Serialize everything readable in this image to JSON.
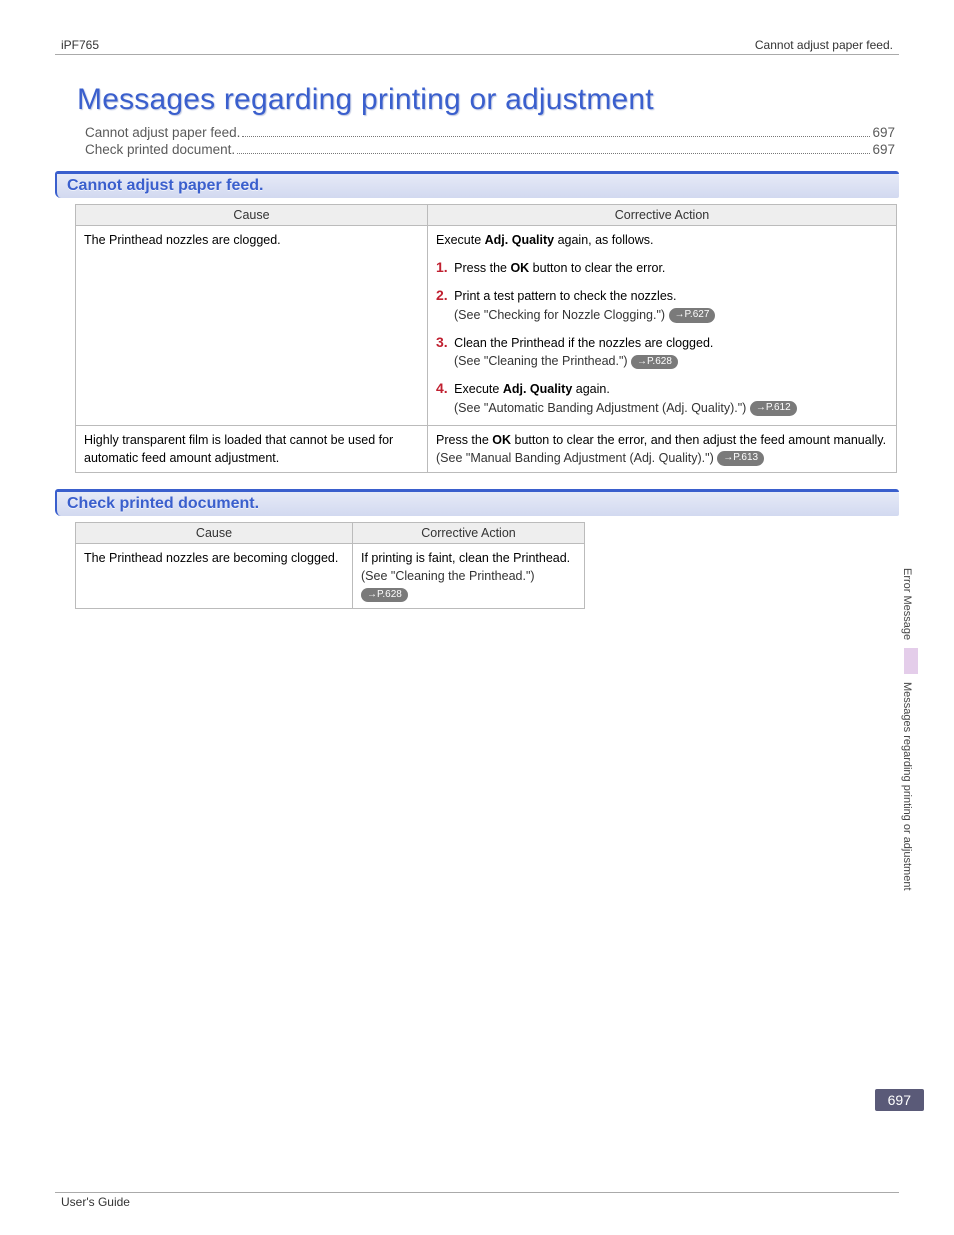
{
  "header": {
    "left": "iPF765",
    "right": "Cannot adjust paper feed."
  },
  "chapterTitle": "Messages regarding printing or adjustment",
  "toc": [
    {
      "label": "Cannot adjust paper feed.",
      "page": "697"
    },
    {
      "label": "Check printed document.",
      "page": "697"
    }
  ],
  "section1": {
    "title": "Cannot adjust paper feed.",
    "headers": {
      "cause": "Cause",
      "action": "Corrective Action"
    },
    "row1": {
      "cause": "The Printhead nozzles are clogged.",
      "intro": "Execute ",
      "introBold": "Adj. Quality",
      "intro2": " again, as follows.",
      "step1a": "Press the ",
      "step1b": "OK",
      "step1c": " button to clear the error.",
      "step2a": "Print a test pattern to check the nozzles.",
      "step2see": "(See \"Checking for Nozzle Clogging.\")",
      "step2pill": "→P.627",
      "step3a": "Clean the Printhead if the nozzles are clogged.",
      "step3see": "(See \"Cleaning the Printhead.\")",
      "step3pill": "→P.628",
      "step4a": "Execute ",
      "step4b": "Adj. Quality",
      "step4c": " again.",
      "step4see": "(See \"Automatic Banding Adjustment (Adj. Quality).\")",
      "step4pill": "→P.612"
    },
    "row2": {
      "cause": "Highly transparent film is loaded that cannot be used for automatic feed amount adjustment.",
      "act1": "Press the ",
      "act1b": "OK",
      "act1c": " button to clear the error, and then adjust the feed amount manually.",
      "act2see": "(See \"Manual Banding Adjustment (Adj. Quality).\")",
      "act2pill": "→P.613"
    }
  },
  "section2": {
    "title": "Check printed document.",
    "headers": {
      "cause": "Cause",
      "action": "Corrective Action"
    },
    "row1": {
      "cause": "The Printhead nozzles are becoming clogged.",
      "act": "If printing is faint, clean the Printhead.",
      "see": "(See \"Cleaning the Printhead.\")",
      "pill": "→P.628"
    }
  },
  "side": {
    "top": "Error Message",
    "bottom": "Messages regarding printing or adjustment"
  },
  "pageNumber": "697",
  "footer": "User's Guide"
}
